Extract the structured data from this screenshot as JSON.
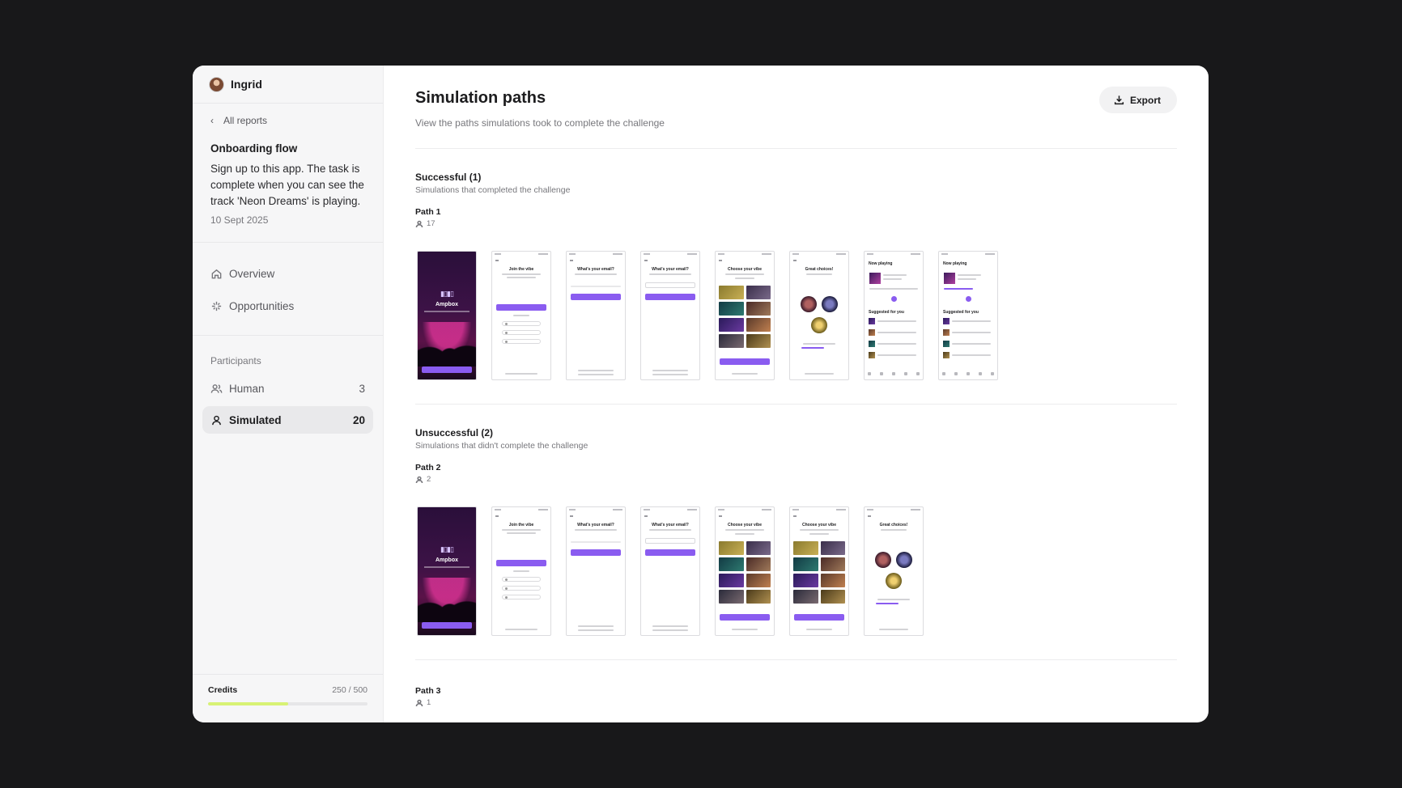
{
  "user": {
    "name": "Ingrid"
  },
  "sidebar": {
    "back_label": "All reports",
    "report": {
      "title": "Onboarding flow",
      "description": "Sign up to this app. The task is complete when you can see the track 'Neon Dreams' is playing.",
      "date": "10 Sept 2025"
    },
    "nav": [
      {
        "label": "Overview",
        "icon": "home-icon"
      },
      {
        "label": "Opportunities",
        "icon": "sparkle-icon"
      }
    ],
    "participants": {
      "heading": "Participants",
      "items": [
        {
          "label": "Human",
          "count": "3",
          "icon": "users-icon"
        },
        {
          "label": "Simulated",
          "count": "20",
          "icon": "user-icon",
          "active": true
        }
      ]
    },
    "credits": {
      "label": "Credits",
      "value": "250 / 500",
      "fraction": 0.5,
      "color": "#d8f275"
    }
  },
  "main": {
    "title": "Simulation paths",
    "subtitle": "View the paths simulations took to complete the challenge",
    "export_label": "Export",
    "sections": [
      {
        "title": "Successful (1)",
        "subtitle": "Simulations that completed the challenge",
        "path": {
          "title": "Path 1",
          "count": "17"
        }
      },
      {
        "title": "Unsuccessful (2)",
        "subtitle": "Simulations that didn't complete the challenge",
        "path": {
          "title": "Path 2",
          "count": "2"
        }
      },
      {
        "path": {
          "title": "Path 3",
          "count": "1"
        }
      }
    ]
  },
  "screens": {
    "brand": "Ampbox",
    "join": "Join the vibe",
    "email": "What's your email?",
    "vibe": "Choose your vibe",
    "great": "Great choices!",
    "now": "Now playing",
    "suggested": "Suggested for you"
  },
  "colors": {
    "accent": "#8a5cf0",
    "background": "#18181a"
  }
}
